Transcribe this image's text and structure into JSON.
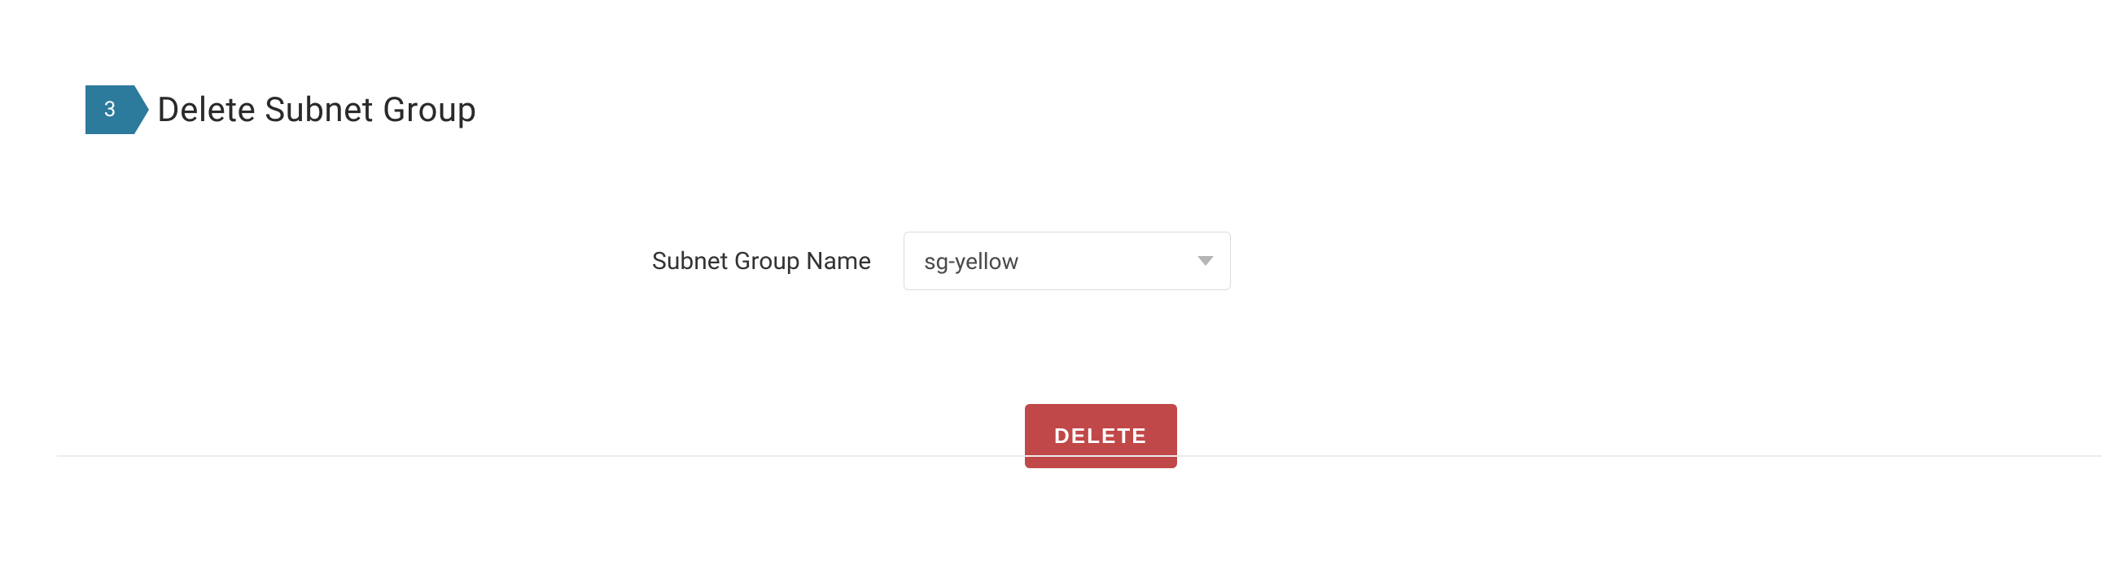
{
  "step": {
    "number": "3",
    "title": "Delete Subnet Group"
  },
  "form": {
    "subnet_group_name_label": "Subnet Group Name",
    "subnet_group_name_value": "sg-yellow"
  },
  "actions": {
    "delete_label": "DELETE"
  },
  "colors": {
    "step_badge_bg": "#2c7a9c",
    "delete_btn_bg": "#c14848"
  }
}
